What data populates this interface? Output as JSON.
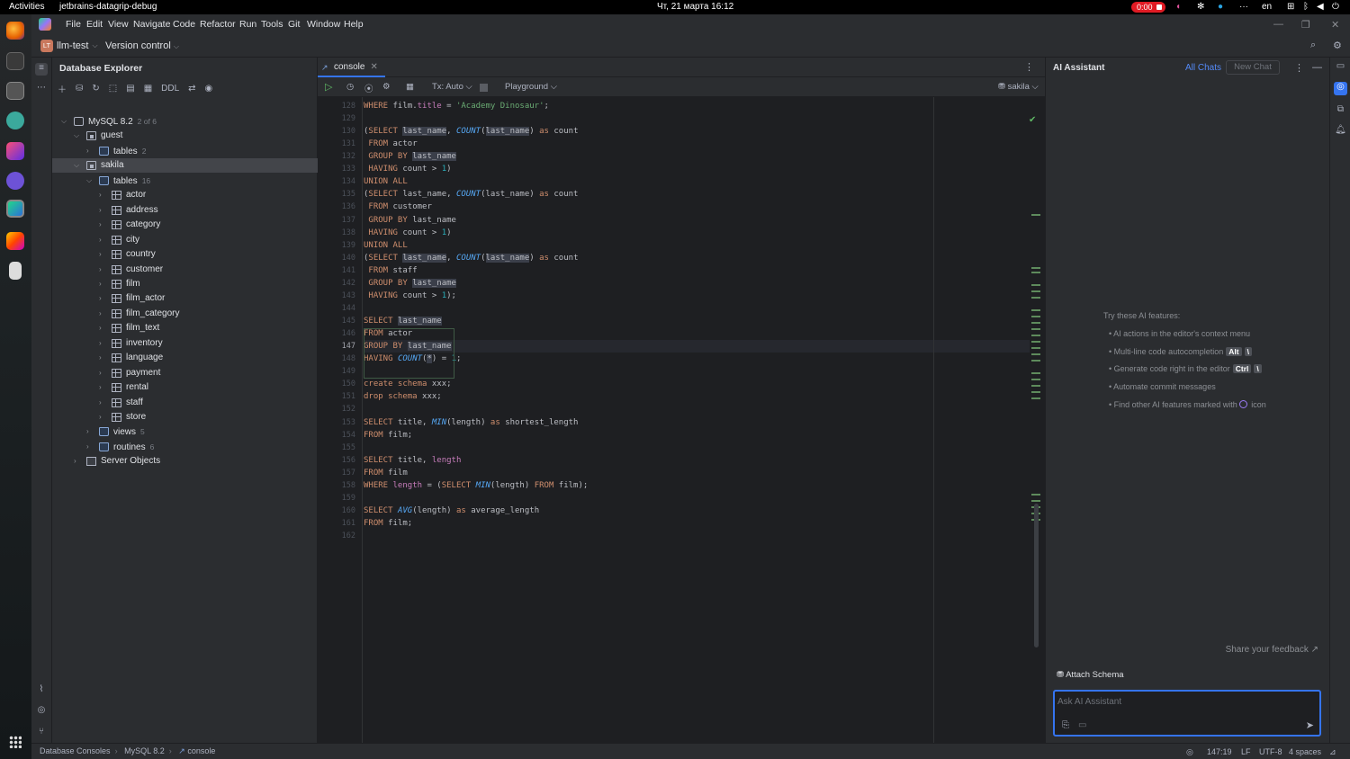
{
  "system_bar": {
    "activities": "Activities",
    "app": "jetbrains-datagrip-debug",
    "clock": "Чт, 21 марта  16:12",
    "recording": "0:00",
    "lang": "en",
    "ellipsis": "···"
  },
  "menu": [
    "File",
    "Edit",
    "View",
    "Navigate",
    "Code",
    "Refactor",
    "Run",
    "Tools",
    "Git",
    "Window",
    "Help"
  ],
  "toolbar": {
    "project_badge": "LT",
    "project": "llm-test",
    "version_control": "Version control"
  },
  "db_explorer": {
    "title": "Database Explorer",
    "ddl": "DDL",
    "tree": [
      {
        "label": "MySQL 8.2",
        "count": "2 of 6",
        "level": 0,
        "icon": "db",
        "open": true
      },
      {
        "label": "guest",
        "level": 1,
        "icon": "schema",
        "open": true
      },
      {
        "label": "tables",
        "count": "2",
        "level": 2,
        "icon": "folder",
        "open": false
      },
      {
        "label": "sakila",
        "level": 1,
        "icon": "schema",
        "open": true,
        "selected": true
      },
      {
        "label": "tables",
        "count": "16",
        "level": 2,
        "icon": "folder",
        "open": true
      },
      {
        "label": "actor",
        "level": 3,
        "icon": "table"
      },
      {
        "label": "address",
        "level": 3,
        "icon": "table"
      },
      {
        "label": "category",
        "level": 3,
        "icon": "table"
      },
      {
        "label": "city",
        "level": 3,
        "icon": "table"
      },
      {
        "label": "country",
        "level": 3,
        "icon": "table"
      },
      {
        "label": "customer",
        "level": 3,
        "icon": "table"
      },
      {
        "label": "film",
        "level": 3,
        "icon": "table"
      },
      {
        "label": "film_actor",
        "level": 3,
        "icon": "table"
      },
      {
        "label": "film_category",
        "level": 3,
        "icon": "table"
      },
      {
        "label": "film_text",
        "level": 3,
        "icon": "table"
      },
      {
        "label": "inventory",
        "level": 3,
        "icon": "table"
      },
      {
        "label": "language",
        "level": 3,
        "icon": "table"
      },
      {
        "label": "payment",
        "level": 3,
        "icon": "table"
      },
      {
        "label": "rental",
        "level": 3,
        "icon": "table"
      },
      {
        "label": "staff",
        "level": 3,
        "icon": "table"
      },
      {
        "label": "store",
        "level": 3,
        "icon": "table"
      },
      {
        "label": "views",
        "count": "5",
        "level": 2,
        "icon": "folder",
        "open": false
      },
      {
        "label": "routines",
        "count": "6",
        "level": 2,
        "icon": "folder",
        "open": false
      },
      {
        "label": "Server Objects",
        "level": 1,
        "icon": "srv",
        "open": false
      }
    ]
  },
  "editor": {
    "tab": "console",
    "tx": "Tx: Auto",
    "playground": "Playground",
    "schema": "sakila",
    "current_line": 147,
    "lines": [
      {
        "n": 128,
        "t": [
          [
            "kw",
            "WHERE "
          ],
          [
            "",
            "film."
          ],
          [
            "col",
            "title"
          ],
          [
            "",
            " = "
          ],
          [
            "str",
            "'Academy Dinosaur'"
          ],
          [
            "",
            ";"
          ]
        ]
      },
      {
        "n": 129,
        "t": []
      },
      {
        "n": 130,
        "t": [
          [
            "",
            "("
          ],
          [
            "kw",
            "SELECT "
          ],
          [
            "hl",
            "last_name"
          ],
          [
            "",
            ", "
          ],
          [
            "fn",
            "COUNT"
          ],
          [
            "",
            "("
          ],
          [
            "hl",
            "last_name"
          ],
          [
            "",
            ") "
          ],
          [
            "kw",
            "as "
          ],
          [
            "",
            "count"
          ]
        ]
      },
      {
        "n": 131,
        "t": [
          [
            "kw",
            " FROM "
          ],
          [
            "",
            "actor"
          ]
        ]
      },
      {
        "n": 132,
        "t": [
          [
            "kw",
            " GROUP BY "
          ],
          [
            "hl",
            "last_name"
          ]
        ]
      },
      {
        "n": 133,
        "t": [
          [
            "kw",
            " HAVING "
          ],
          [
            "",
            "count > "
          ],
          [
            "num",
            "1"
          ],
          [
            "",
            ")"
          ]
        ]
      },
      {
        "n": 134,
        "t": [
          [
            "kw",
            "UNION ALL"
          ]
        ]
      },
      {
        "n": 135,
        "t": [
          [
            "",
            "("
          ],
          [
            "kw",
            "SELECT "
          ],
          [
            "",
            "last_name, "
          ],
          [
            "fn",
            "COUNT"
          ],
          [
            "",
            "(last_name) "
          ],
          [
            "kw",
            "as "
          ],
          [
            "",
            "count"
          ]
        ]
      },
      {
        "n": 136,
        "t": [
          [
            "kw",
            " FROM "
          ],
          [
            "",
            "customer"
          ]
        ]
      },
      {
        "n": 137,
        "t": [
          [
            "kw",
            " GROUP BY "
          ],
          [
            "",
            "last_name"
          ]
        ]
      },
      {
        "n": 138,
        "t": [
          [
            "kw",
            " HAVING "
          ],
          [
            "",
            "count > "
          ],
          [
            "num",
            "1"
          ],
          [
            "",
            ")"
          ]
        ]
      },
      {
        "n": 139,
        "t": [
          [
            "kw",
            "UNION ALL"
          ]
        ]
      },
      {
        "n": 140,
        "t": [
          [
            "",
            "("
          ],
          [
            "kw",
            "SELECT "
          ],
          [
            "hl",
            "last_name"
          ],
          [
            "",
            ", "
          ],
          [
            "fn",
            "COUNT"
          ],
          [
            "",
            "("
          ],
          [
            "hl",
            "last_name"
          ],
          [
            "",
            ") "
          ],
          [
            "kw",
            "as "
          ],
          [
            "",
            "count"
          ]
        ]
      },
      {
        "n": 141,
        "t": [
          [
            "kw",
            " FROM "
          ],
          [
            "",
            "staff"
          ]
        ]
      },
      {
        "n": 142,
        "t": [
          [
            "kw",
            " GROUP BY "
          ],
          [
            "hl",
            "last_name"
          ]
        ]
      },
      {
        "n": 143,
        "t": [
          [
            "kw",
            " HAVING "
          ],
          [
            "",
            "count > "
          ],
          [
            "num",
            "1"
          ],
          [
            "",
            ");"
          ]
        ]
      },
      {
        "n": 144,
        "t": []
      },
      {
        "n": 145,
        "t": [
          [
            "kw",
            "SELECT "
          ],
          [
            "hl",
            "last_name"
          ]
        ]
      },
      {
        "n": 146,
        "t": [
          [
            "kw",
            "FROM "
          ],
          [
            "",
            "actor"
          ]
        ]
      },
      {
        "n": 147,
        "t": [
          [
            "kw",
            "GROUP BY "
          ],
          [
            "hl",
            "last_name"
          ]
        ]
      },
      {
        "n": 148,
        "t": [
          [
            "kw",
            "HAVING "
          ],
          [
            "fn",
            "COUNT"
          ],
          [
            "",
            "("
          ],
          [
            "hl",
            "*"
          ],
          [
            "",
            ") = "
          ],
          [
            "num",
            "1"
          ],
          [
            "",
            ";"
          ]
        ]
      },
      {
        "n": 149,
        "t": []
      },
      {
        "n": 150,
        "t": [
          [
            "kw",
            "create schema "
          ],
          [
            "",
            "xxx;"
          ]
        ]
      },
      {
        "n": 151,
        "t": [
          [
            "kw",
            "drop schema "
          ],
          [
            "",
            "xxx;"
          ]
        ]
      },
      {
        "n": 152,
        "t": []
      },
      {
        "n": 153,
        "t": [
          [
            "kw",
            "SELECT "
          ],
          [
            "",
            "title, "
          ],
          [
            "fn",
            "MIN"
          ],
          [
            "",
            "(length) "
          ],
          [
            "kw",
            "as "
          ],
          [
            "",
            "shortest_length"
          ]
        ]
      },
      {
        "n": 154,
        "t": [
          [
            "kw",
            "FROM "
          ],
          [
            "",
            "film;"
          ]
        ]
      },
      {
        "n": 155,
        "t": []
      },
      {
        "n": 156,
        "t": [
          [
            "kw",
            "SELECT "
          ],
          [
            "",
            "title, "
          ],
          [
            "col",
            "length"
          ]
        ]
      },
      {
        "n": 157,
        "t": [
          [
            "kw",
            "FROM "
          ],
          [
            "",
            "film"
          ]
        ]
      },
      {
        "n": 158,
        "t": [
          [
            "kw",
            "WHERE "
          ],
          [
            "col",
            "length"
          ],
          [
            "",
            " = ("
          ],
          [
            "kw",
            "SELECT "
          ],
          [
            "fn",
            "MIN"
          ],
          [
            "",
            "(length) "
          ],
          [
            "kw",
            "FROM "
          ],
          [
            "",
            "film);"
          ]
        ]
      },
      {
        "n": 159,
        "t": []
      },
      {
        "n": 160,
        "t": [
          [
            "kw",
            "SELECT "
          ],
          [
            "fn",
            "AVG"
          ],
          [
            "",
            "(length) "
          ],
          [
            "kw",
            "as "
          ],
          [
            "",
            "average_length"
          ]
        ]
      },
      {
        "n": 161,
        "t": [
          [
            "kw",
            "FROM "
          ],
          [
            "",
            "film;"
          ]
        ]
      },
      {
        "n": 162,
        "t": []
      }
    ]
  },
  "ai_assistant": {
    "title": "AI Assistant",
    "all_chats": "All Chats",
    "new_chat": "New Chat",
    "try_title": "Try these AI features:",
    "features": [
      {
        "text": "AI actions in the editor's context menu"
      },
      {
        "text": "Multi-line code autocompletion",
        "keys": [
          "Alt",
          "\\"
        ]
      },
      {
        "text": "Generate code right in the editor",
        "keys": [
          "Ctrl",
          "\\"
        ]
      },
      {
        "text": "Automate commit messages"
      },
      {
        "text": "Find other AI features marked with",
        "icon": true,
        "suffix": "icon"
      }
    ],
    "share": "Share your feedback ↗",
    "attach": "Attach Schema",
    "placeholder": "Ask AI Assistant"
  },
  "status": {
    "breadcrumbs": [
      "Database Consoles",
      "MySQL 8.2",
      "console"
    ],
    "position": "147:19",
    "line_ending": "LF",
    "encoding": "UTF-8",
    "indent": "4 spaces"
  }
}
